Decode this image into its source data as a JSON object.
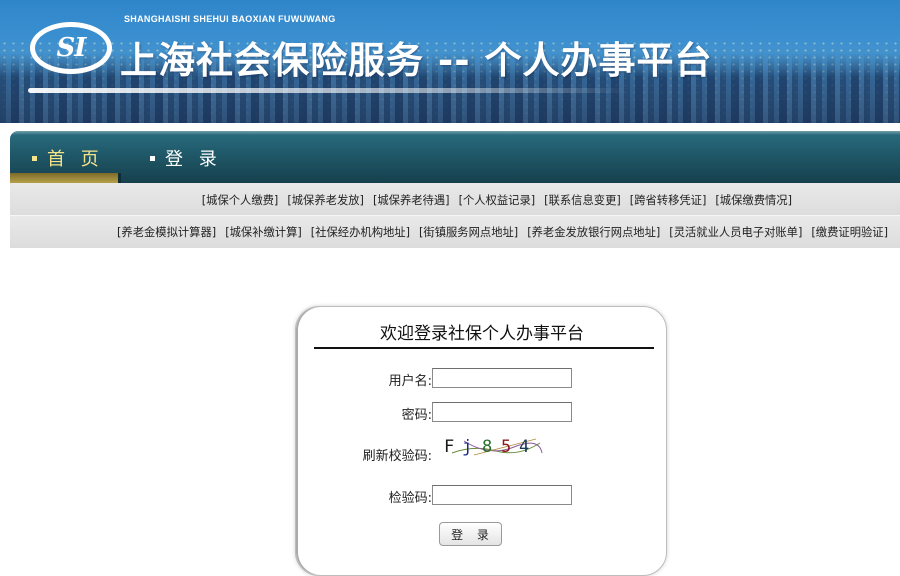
{
  "header": {
    "logo_text": "SI",
    "pinyin": "SHANGHAISHI SHEHUI BAOXIAN FUWUWANG",
    "title": "上海社会保险服务 -- 个人办事平台"
  },
  "nav": {
    "items": [
      {
        "label": "首 页",
        "active": true
      },
      {
        "label": "登 录",
        "active": false
      }
    ]
  },
  "links_row1": [
    "[城保个人缴费]",
    "[城保养老发放]",
    "[城保养老待遇]",
    "[个人权益记录]",
    "[联系信息变更]",
    "[跨省转移凭证]",
    "[城保缴费情况]"
  ],
  "links_row2": [
    "[养老金模拟计算器]",
    "[城保补缴计算]",
    "[社保经办机构地址]",
    "[街镇服务网点地址]",
    "[养老金发放银行网点地址]",
    "[灵活就业人员电子对账单]",
    "[缴费证明验证]"
  ],
  "login": {
    "title": "欢迎登录社保个人办事平台",
    "username_label": "用户名:",
    "username_value": "",
    "password_label": "密码:",
    "password_value": "",
    "refresh_label": "刷新校验码:",
    "captcha_chars": [
      "F",
      "j",
      "8",
      "5",
      "4"
    ],
    "captcha_colors": [
      "#1a1a1a",
      "#1a2a8a",
      "#2a6e2a",
      "#8a1a1a",
      "#1a3a5a"
    ],
    "verify_label": "检验码:",
    "verify_value": "",
    "submit_label": "登 录"
  }
}
